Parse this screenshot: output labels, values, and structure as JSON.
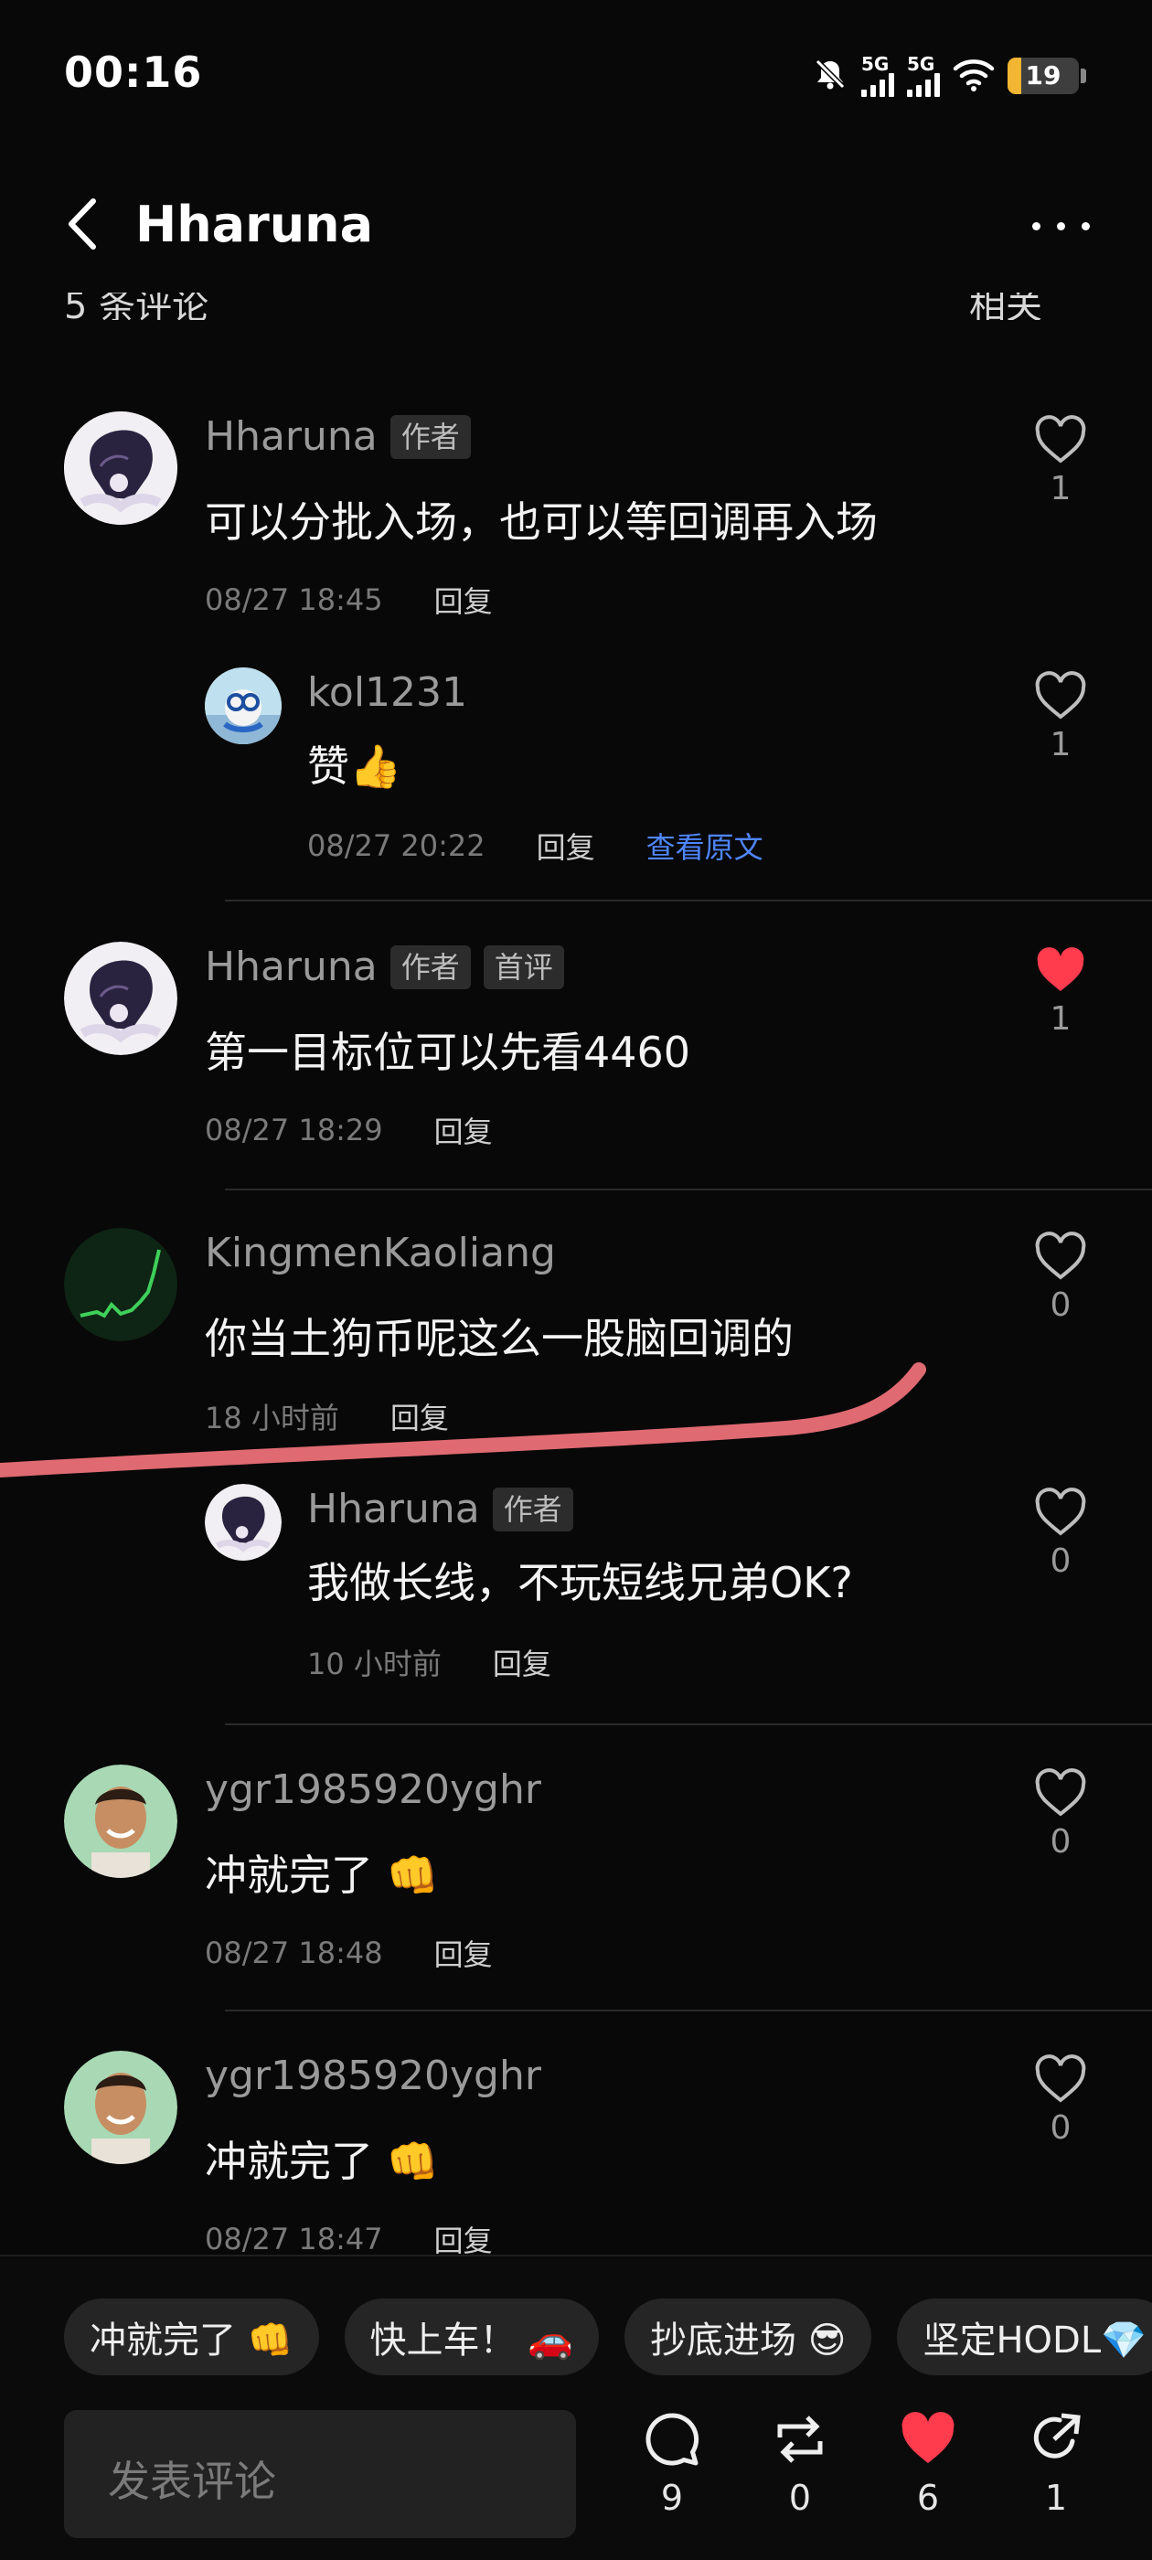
{
  "status_bar": {
    "time": "00:16",
    "signal1": "5G",
    "signal2": "5G",
    "battery": "19",
    "battery_level_pct": 19
  },
  "header": {
    "title": "Hharuna"
  },
  "clipped_header": {
    "left": "5 条评论",
    "right": "相关"
  },
  "comments": [
    {
      "user": "Hharuna",
      "tags": [
        "作者"
      ],
      "text": "可以分批入场，也可以等回调再入场",
      "date": "08/27 18:45",
      "reply": "回复",
      "likes": "1",
      "liked": false,
      "replies": [
        {
          "user": "kol1231",
          "text": "赞👍",
          "date": "08/27 20:22",
          "reply": "回复",
          "view_original": "查看原文",
          "likes": "1"
        }
      ]
    },
    {
      "user": "Hharuna",
      "tags": [
        "作者",
        "首评"
      ],
      "text": "第一目标位可以先看4460",
      "date": "08/27 18:29",
      "reply": "回复",
      "likes": "1",
      "liked": true
    },
    {
      "user": "KingmenKaoliang",
      "text": "你当土狗币呢这么一股脑回调的",
      "date": "18 小时前",
      "reply": "回复",
      "likes": "0",
      "liked": false,
      "replies": [
        {
          "user": "Hharuna",
          "tags": [
            "作者"
          ],
          "text": "我做长线，不玩短线兄弟OK?",
          "date": "10 小时前",
          "reply": "回复",
          "likes": "0"
        }
      ]
    },
    {
      "user": "ygr1985920yghr",
      "text": "冲就完了 👊",
      "date": "08/27 18:48",
      "reply": "回复",
      "likes": "0",
      "liked": false
    },
    {
      "user": "ygr1985920yghr",
      "text": "冲就完了 👊",
      "date": "08/27 18:47",
      "reply": "回复",
      "likes": "0",
      "liked": false
    }
  ],
  "quick_replies": [
    "冲就完了 👊",
    "快上车！ 🚗",
    "抄底进场 😎",
    "坚定HODL💎"
  ],
  "input": {
    "placeholder": "发表评论"
  },
  "actions": {
    "comments": "9",
    "reposts": "0",
    "likes": "6",
    "shares": "1"
  },
  "colors": {
    "accent_blue": "#4f86ff",
    "like_red": "#ff3b4e",
    "scribble": "#e06a72",
    "battery": "#f2b632"
  },
  "icons": [
    "back-icon",
    "more-icon",
    "heart-icon",
    "comment-icon",
    "repost-icon",
    "share-icon",
    "wifi-icon",
    "mute-bell-icon"
  ]
}
